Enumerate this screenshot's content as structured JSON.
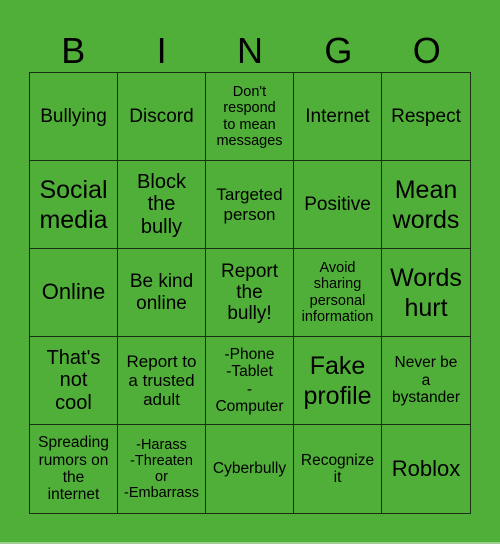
{
  "header": {
    "letters": [
      "B",
      "I",
      "N",
      "G",
      "O"
    ]
  },
  "colors": {
    "background": "#50af38",
    "grid_line": "#1a2e14",
    "text": "#000000"
  },
  "cells": [
    "Bullying",
    "Discord",
    "Don't\nrespond\nto mean\nmessages",
    "Internet",
    "Respect",
    "Social\nmedia",
    "Block\nthe\nbully",
    "Targeted\nperson",
    "Positive",
    "Mean\nwords",
    "Online",
    "Be kind\nonline",
    "Report\nthe\nbully!",
    "Avoid\nsharing\npersonal\ninformation",
    "Words\nhurt",
    "That's\nnot\ncool",
    "Report to\na trusted\nadult",
    "-Phone\n-Tablet\n-\nComputer",
    "Fake\nprofile",
    "Never be\na\nbystander",
    "Spreading\nrumors on\nthe\ninternet",
    "-Harass\n-Threaten\nor\n-Embarrass",
    "Cyberbully",
    "Recognize\nit",
    "Roblox"
  ]
}
